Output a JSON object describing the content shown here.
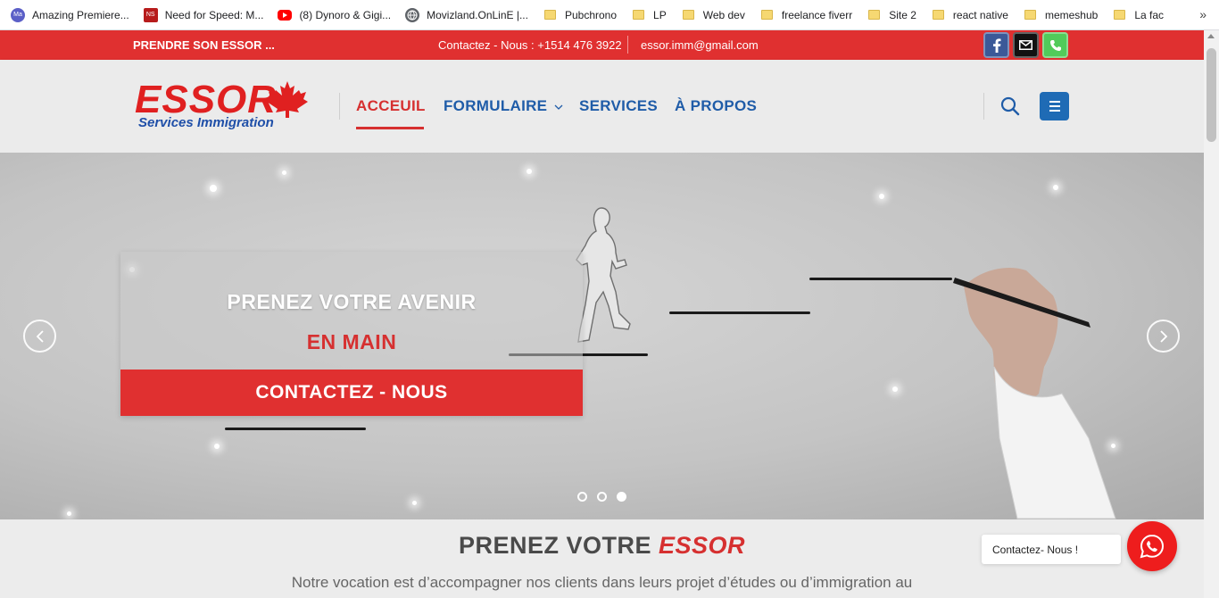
{
  "bookmarks": {
    "items": [
      {
        "label": "Amazing Premiere...",
        "icon": "ma-badge-icon",
        "icon_text": "Ma",
        "color": "#5b5fc7"
      },
      {
        "label": "Need for Speed: M...",
        "icon": "nfs-icon",
        "icon_text": "NS",
        "color": "#b71c1c"
      },
      {
        "label": "(8) Dynoro & Gigi...",
        "icon": "youtube-icon",
        "color": "#ff0000"
      },
      {
        "label": "Movizland.OnLinE |...",
        "icon": "globe-icon",
        "color": "#5f6368"
      },
      {
        "label": "Pubchrono",
        "icon": "folder-icon"
      },
      {
        "label": "LP",
        "icon": "folder-icon"
      },
      {
        "label": "Web dev",
        "icon": "folder-icon"
      },
      {
        "label": "freelance fiverr",
        "icon": "folder-icon"
      },
      {
        "label": "Site 2",
        "icon": "folder-icon"
      },
      {
        "label": "react native",
        "icon": "folder-icon"
      },
      {
        "label": "memeshub",
        "icon": "folder-icon"
      },
      {
        "label": "La fac",
        "icon": "folder-icon"
      }
    ],
    "more": "»"
  },
  "topbar": {
    "tagline": "PRENDRE SON ESSOR ...",
    "phone": "Contactez - Nous : +1514 476 3922",
    "email": "essor.imm@gmail.com",
    "color": "#e03030"
  },
  "logo": {
    "word": "ESSOR",
    "subtitle": "Services Immigration"
  },
  "nav": {
    "items": [
      "ACCEUIL",
      "FORMULAIRE",
      "SERVICES",
      "À PROPOS"
    ],
    "active": "ACCEUIL"
  },
  "hero": {
    "line1": "PRENEZ VOTRE AVENIR",
    "line2": "EN MAIN",
    "cta": "CONTACTEZ - NOUS",
    "slides": 3,
    "active_slide": 3
  },
  "intro": {
    "title_plain": "PRENEZ VOTRE ",
    "title_em": "ESSOR",
    "text": "Notre vocation est d’accompagner nos clients dans leurs projet d’études ou d’immigration au"
  },
  "chat": {
    "label": "Contactez- Nous !"
  }
}
